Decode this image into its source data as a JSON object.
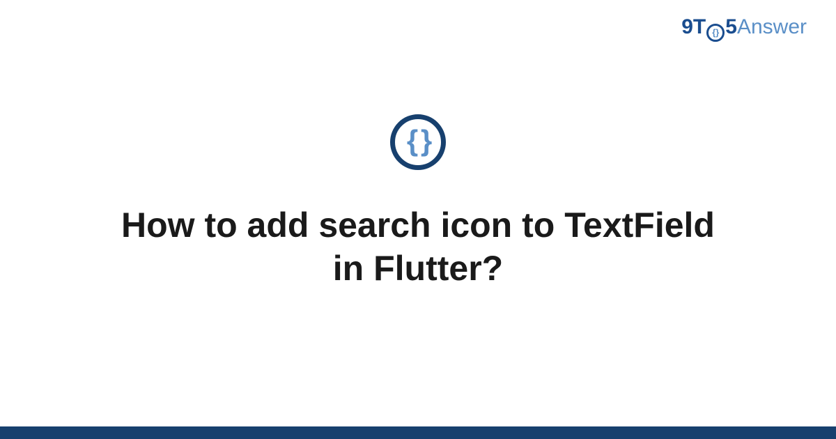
{
  "logo": {
    "part1": "9T",
    "circle_inner": "{}",
    "part2": "5",
    "part3": "Answer"
  },
  "icon": {
    "braces": "{ }"
  },
  "title": "How to add search icon to TextField in Flutter?",
  "colors": {
    "brand_dark": "#17406e",
    "brand_mid": "#1a4d8f",
    "brand_light": "#5a8fc7"
  }
}
